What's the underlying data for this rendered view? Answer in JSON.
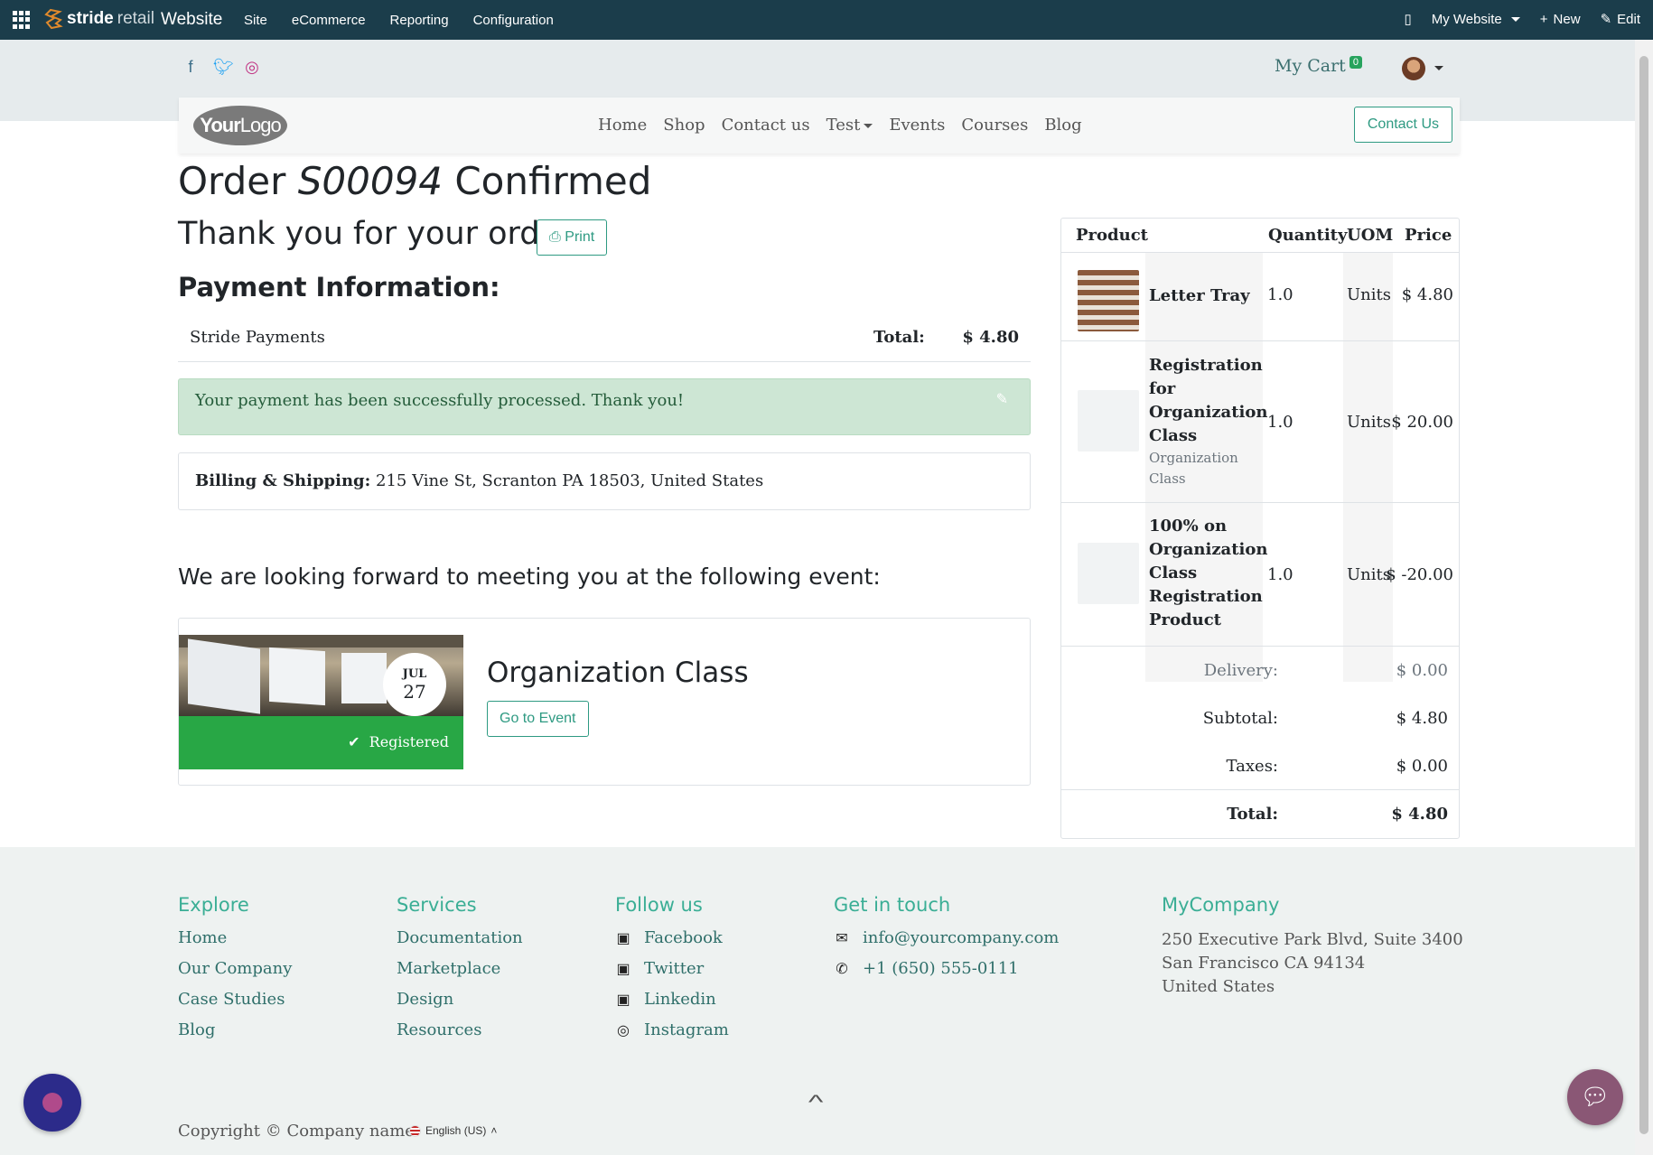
{
  "adminbar": {
    "brand_bold": "stride",
    "brand_light": "retail",
    "app_name": "Website",
    "menu": [
      "Site",
      "eCommerce",
      "Reporting",
      "Configuration"
    ],
    "website_selector": "My Website",
    "new_label": "New",
    "edit_label": "Edit"
  },
  "header": {
    "cart_label": "My Cart",
    "cart_count": "0",
    "logo_bold": "Your",
    "logo_light": "Logo",
    "nav": [
      "Home",
      "Shop",
      "Contact us",
      "Test",
      "Events",
      "Courses",
      "Blog"
    ],
    "contact_button": "Contact Us"
  },
  "order": {
    "title_prefix": "Order",
    "order_number": "S00094",
    "title_suffix": "Confirmed",
    "thanks": "Thank you for your order.",
    "print_label": "Print",
    "payment_heading": "Payment Information:",
    "payment_method": "Stride Payments",
    "total_label": "Total:",
    "total_value": "$ 4.80",
    "success_message": "Your payment has been successfully processed. Thank you!",
    "billing_label": "Billing & Shipping:",
    "billing_address": "215 Vine St, Scranton PA 18503, United States"
  },
  "event": {
    "heading": "We are looking forward to meeting you at the following event:",
    "month": "JUL",
    "day": "27",
    "registered_label": "Registered",
    "name": "Organization Class",
    "go_button": "Go to Event"
  },
  "cart_table": {
    "headers": [
      "Product",
      "Quantity",
      "UOM",
      "Price"
    ],
    "rows": [
      {
        "name": "Letter Tray",
        "description": "",
        "qty": "1.0",
        "uom": "Units",
        "price": "$ 4.80"
      },
      {
        "name": "Registration for Organization Class",
        "description": "Organization Class",
        "qty": "1.0",
        "uom": "Units",
        "price": "$ 20.00"
      },
      {
        "name": "100% on Organization Class Registration Product",
        "description": "",
        "qty": "1.0",
        "uom": "Units",
        "price": "$ -20.00"
      }
    ],
    "delivery_label": "Delivery:",
    "delivery_value": "$ 0.00",
    "subtotal_label": "Subtotal:",
    "subtotal_value": "$ 4.80",
    "taxes_label": "Taxes:",
    "taxes_value": "$ 0.00",
    "total_label": "Total:",
    "total_value": "$ 4.80"
  },
  "footer": {
    "explore": {
      "title": "Explore",
      "links": [
        "Home",
        "Our Company",
        "Case Studies",
        "Blog"
      ]
    },
    "services": {
      "title": "Services",
      "links": [
        "Documentation",
        "Marketplace",
        "Design",
        "Resources"
      ]
    },
    "follow": {
      "title": "Follow us",
      "links": [
        "Facebook",
        "Twitter",
        "Linkedin",
        "Instagram"
      ]
    },
    "contact": {
      "title": "Get in touch",
      "email": "info@yourcompany.com",
      "phone": "+1 (650) 555-0111"
    },
    "company": {
      "title": "MyCompany",
      "address_lines": [
        "250 Executive Park Blvd, Suite 3400",
        "San Francisco CA 94134",
        "United States"
      ]
    },
    "copyright": "Copyright © Company name",
    "language": "English (US)"
  },
  "colors": {
    "accent": "#2e9a82",
    "adminbar": "#1b3d4b",
    "success": "#28a745"
  }
}
